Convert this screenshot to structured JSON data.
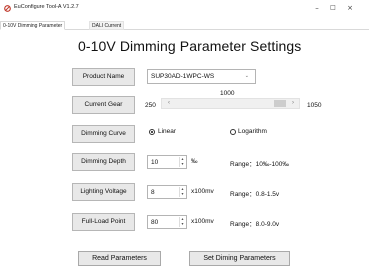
{
  "window": {
    "title": "EuConfigure Tool-A V1.2.7",
    "minimize": "–",
    "maximize": "□",
    "close": "×"
  },
  "tabs": [
    {
      "label": "0-10V Dimming Parameter",
      "active": true
    },
    {
      "label": "DALI Current",
      "active": false
    }
  ],
  "page_title": "0-10V Dimming Parameter Settings",
  "product": {
    "label": "Product Name",
    "selected": "SUP30AD-1WPC-WS"
  },
  "current_gear": {
    "label": "Current Gear",
    "min": "250",
    "max": "1050",
    "value": "1000"
  },
  "dimming_curve": {
    "label": "Dimming Curve",
    "options": [
      {
        "label": "Linear",
        "selected": true
      },
      {
        "label": "Logarithm",
        "selected": false
      }
    ]
  },
  "dimming_depth": {
    "label": "Dimming Depth",
    "value": "10",
    "unit": "‰",
    "range": "Range：10‰-100‰"
  },
  "lighting_voltage": {
    "label": "Lighting Voltage",
    "value": "8",
    "unit": "x100mv",
    "range": "Range：0.8-1.5v"
  },
  "full_load_point": {
    "label": "Full-Load Point",
    "value": "80",
    "unit": "x100mv",
    "range": "Range：8.0-9.0v"
  },
  "buttons": {
    "read": "Read Parameters",
    "set": "Set Diming Parameters"
  },
  "colors": {
    "button_bg": "#e8e8e8",
    "button_border": "#b6b6b6",
    "app_icon": "#c0392b"
  },
  "icons": {
    "app": "app-logo-icon",
    "dropdown": "chevron-down-icon",
    "scroll_left": "chevron-left-icon",
    "scroll_right": "chevron-right-icon",
    "spin_up": "spin-up-icon",
    "spin_down": "spin-down-icon"
  }
}
